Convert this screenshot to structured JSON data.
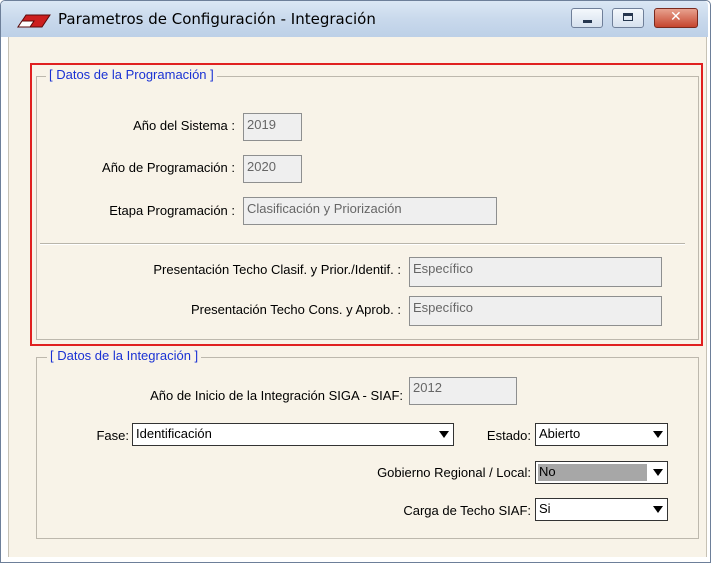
{
  "window": {
    "title": "Parametros de Configuración - Integración",
    "icon": "eraser-icon"
  },
  "programacion": {
    "legend": "[ Datos de la Programación ]",
    "anio_sistema": {
      "label": "Año del Sistema :",
      "value": "2019"
    },
    "anio_programacion": {
      "label": "Año de Programación :",
      "value": "2020"
    },
    "etapa": {
      "label": "Etapa Programación :",
      "value": "Clasificación y Priorización"
    },
    "techo_clasif": {
      "label": "Presentación Techo Clasif. y Prior./Identif. :",
      "value": "Específico"
    },
    "techo_cons": {
      "label": "Presentación Techo Cons. y Aprob. :",
      "value": "Específico"
    }
  },
  "integracion": {
    "legend": "[ Datos de la Integración ]",
    "anio_inicio": {
      "label": "Año de Inicio de la Integración SIGA - SIAF:",
      "value": "2012"
    },
    "fase": {
      "label": "Fase:",
      "value": "Identificación"
    },
    "estado": {
      "label": "Estado:",
      "value": "Abierto"
    },
    "gobierno": {
      "label": "Gobierno Regional / Local:",
      "value": "No"
    },
    "carga_techo": {
      "label": "Carga de Techo SIAF:",
      "value": "Si"
    }
  },
  "colors": {
    "highlight_border": "#e02020",
    "legend_text": "#1a32d4",
    "panel_background": "#f8f3e8"
  }
}
